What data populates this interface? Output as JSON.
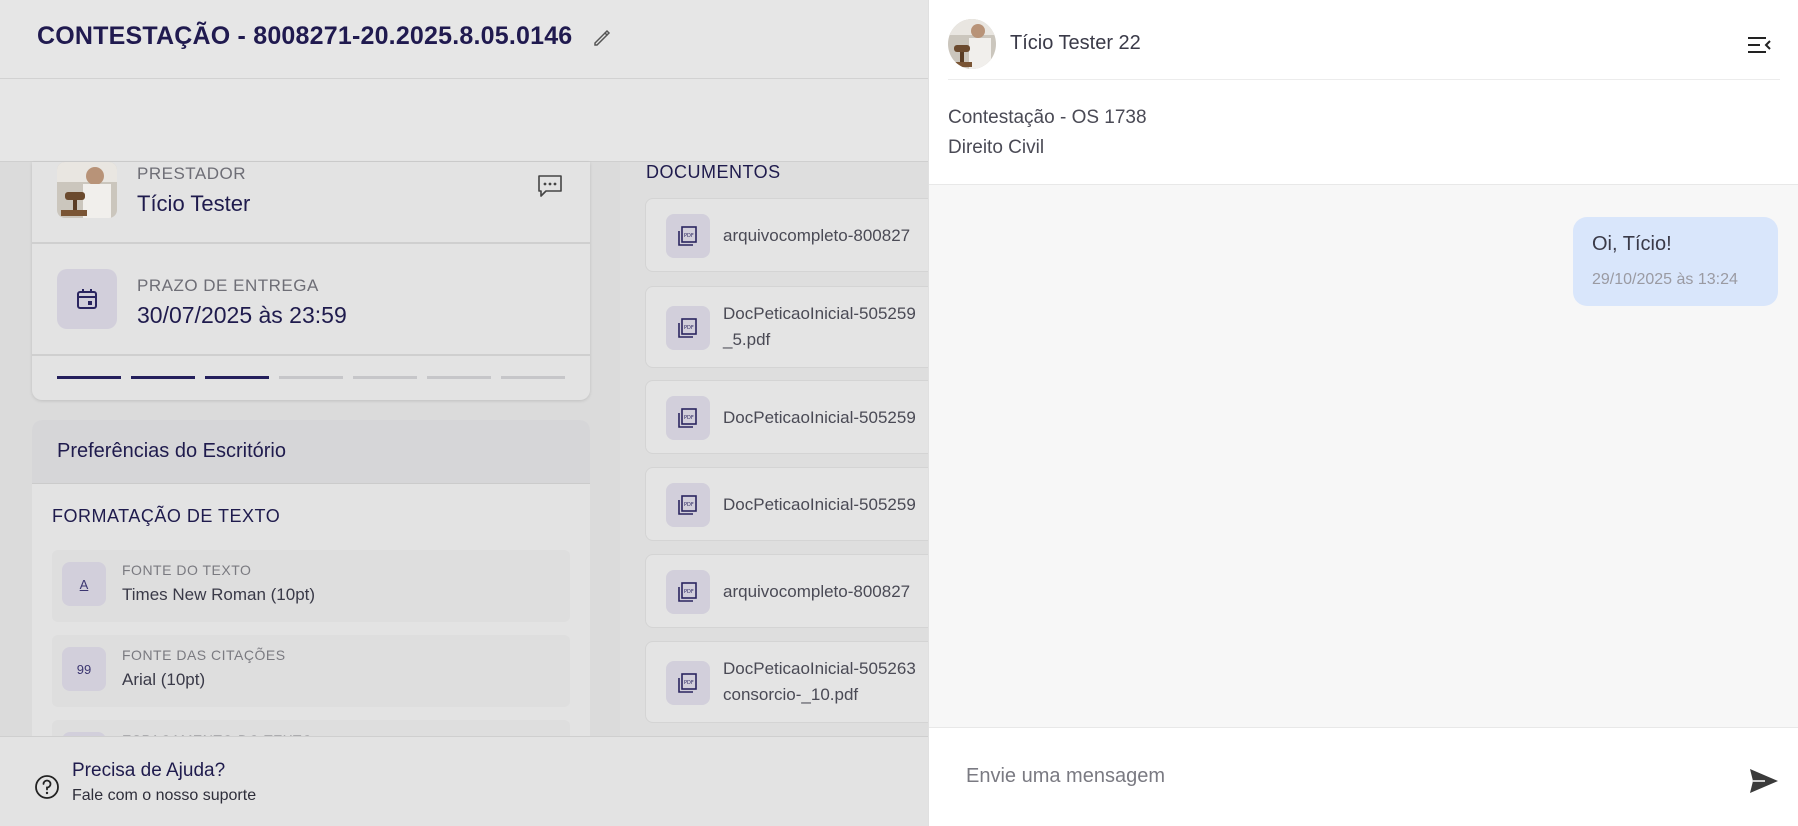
{
  "header": {
    "title": "CONTESTAÇÃO - 8008271-20.2025.8.05.0146",
    "edit_icon": "pencil-icon"
  },
  "prestador": {
    "label": "PRESTADOR",
    "name": "Tício Tester",
    "chat_icon": "chat-bubble-icon"
  },
  "prazo": {
    "label": "PRAZO DE ENTREGA",
    "value": "30/07/2025 às 23:59",
    "icon": "calendar-icon"
  },
  "progress": {
    "steps_total": 7,
    "steps_done": 3
  },
  "preferences": {
    "title": "Preferências do Escritório",
    "section": "FORMATAÇÃO DE TEXTO",
    "items": [
      {
        "icon_text": "A",
        "label": "FONTE DO TEXTO",
        "value": "Times New Roman (10pt)"
      },
      {
        "icon_text": "99",
        "label": "FONTE DAS CITAÇÕES",
        "value": "Arial (10pt)"
      },
      {
        "icon_text": "",
        "label": "ESPAÇAMENTO DO TEXTO",
        "value": ""
      }
    ]
  },
  "documents": {
    "title": "DOCUMENTOS",
    "items": [
      {
        "line1": "arquivocompleto-800827",
        "line2": ""
      },
      {
        "line1": "DocPeticaoInicial-505259",
        "line2": "_5.pdf"
      },
      {
        "line1": "DocPeticaoInicial-505259",
        "line2": ""
      },
      {
        "line1": "DocPeticaoInicial-505259",
        "line2": ""
      },
      {
        "line1": "arquivocompleto-800827",
        "line2": ""
      },
      {
        "line1": "DocPeticaoInicial-505263",
        "line2": "consorcio-_10.pdf"
      }
    ]
  },
  "help": {
    "title": "Precisa de Ajuda?",
    "subtitle": "Fale com o nosso suporte"
  },
  "chat": {
    "user_name": "Tício Tester 22",
    "context_title": "Contestação - OS 1738",
    "context_area": "Direito Civil",
    "messages": [
      {
        "text": "Oi, Tício!",
        "time": "29/10/2025 às 13:24",
        "side": "right"
      }
    ],
    "input_placeholder": "Envie uma mensagem",
    "colors": {
      "bubble": "#d9e6fb",
      "accent": "#241f5c"
    }
  }
}
